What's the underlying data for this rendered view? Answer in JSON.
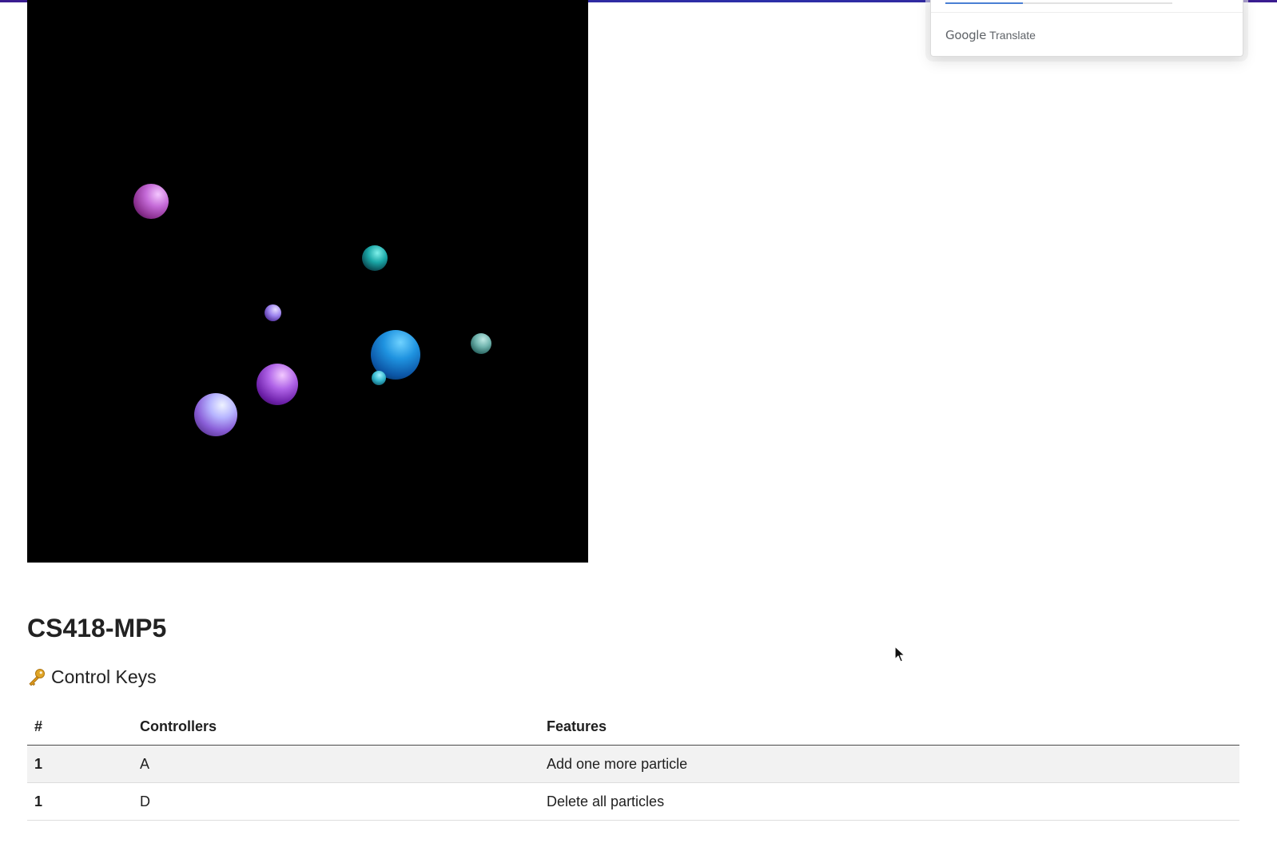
{
  "translate_widget": {
    "brand_google": "Google",
    "brand_translate": "Translate",
    "progress": 0.34
  },
  "page": {
    "title": "CS418-MP5",
    "section_heading": "Control Keys",
    "section_icon": "key-icon"
  },
  "table": {
    "headers": [
      "#",
      "Controllers",
      "Features"
    ],
    "rows": [
      {
        "num": "1",
        "controller": "A",
        "feature": "Add one more particle"
      },
      {
        "num": "1",
        "controller": "D",
        "feature": "Delete all particles"
      }
    ]
  },
  "colors": {
    "canvas_background": "#000000",
    "top_accent": "#2c2fa8",
    "progress_bar": "#4a7fd4"
  }
}
